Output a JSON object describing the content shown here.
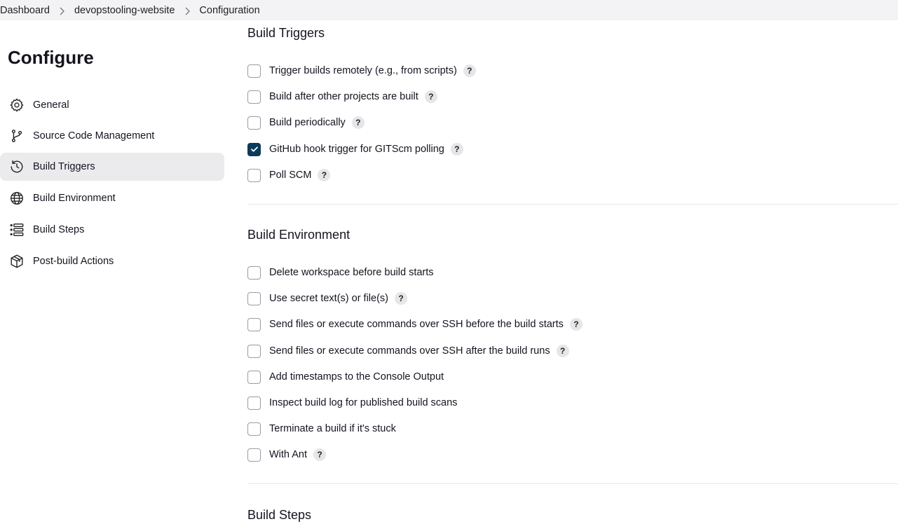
{
  "breadcrumb": {
    "items": [
      "Dashboard",
      "devopstooling-website",
      "Configuration"
    ]
  },
  "sidebar": {
    "title": "Configure",
    "items": [
      {
        "label": "General",
        "icon": "gear-icon"
      },
      {
        "label": "Source Code Management",
        "icon": "branch-icon"
      },
      {
        "label": "Build Triggers",
        "icon": "clock-icon",
        "active": true
      },
      {
        "label": "Build Environment",
        "icon": "globe-icon"
      },
      {
        "label": "Build Steps",
        "icon": "list-icon"
      },
      {
        "label": "Post-build Actions",
        "icon": "package-icon"
      }
    ]
  },
  "build_triggers": {
    "title": "Build Triggers",
    "options": [
      {
        "label": "Trigger builds remotely (e.g., from scripts)",
        "checked": false,
        "help": "?"
      },
      {
        "label": "Build after other projects are built",
        "checked": false,
        "help": "?"
      },
      {
        "label": "Build periodically",
        "checked": false,
        "help": "?"
      },
      {
        "label": "GitHub hook trigger for GITScm polling",
        "checked": true,
        "help": "?"
      },
      {
        "label": "Poll SCM",
        "checked": false,
        "help": "?"
      }
    ]
  },
  "build_environment": {
    "title": "Build Environment",
    "options": [
      {
        "label": "Delete workspace before build starts",
        "checked": false
      },
      {
        "label": "Use secret text(s) or file(s)",
        "checked": false,
        "help": "?"
      },
      {
        "label": "Send files or execute commands over SSH before the build starts",
        "checked": false,
        "help": "?"
      },
      {
        "label": "Send files or execute commands over SSH after the build runs",
        "checked": false,
        "help": "?"
      },
      {
        "label": "Add timestamps to the Console Output",
        "checked": false
      },
      {
        "label": "Inspect build log for published build scans",
        "checked": false
      },
      {
        "label": "Terminate a build if it's stuck",
        "checked": false
      },
      {
        "label": "With Ant",
        "checked": false,
        "help": "?"
      }
    ]
  },
  "build_steps": {
    "title": "Build Steps"
  },
  "colors": {
    "checkbox_checked": "#0b3b5b",
    "active_nav_bg": "#ebebee",
    "breadcrumb_bg": "#f3f3f5"
  }
}
